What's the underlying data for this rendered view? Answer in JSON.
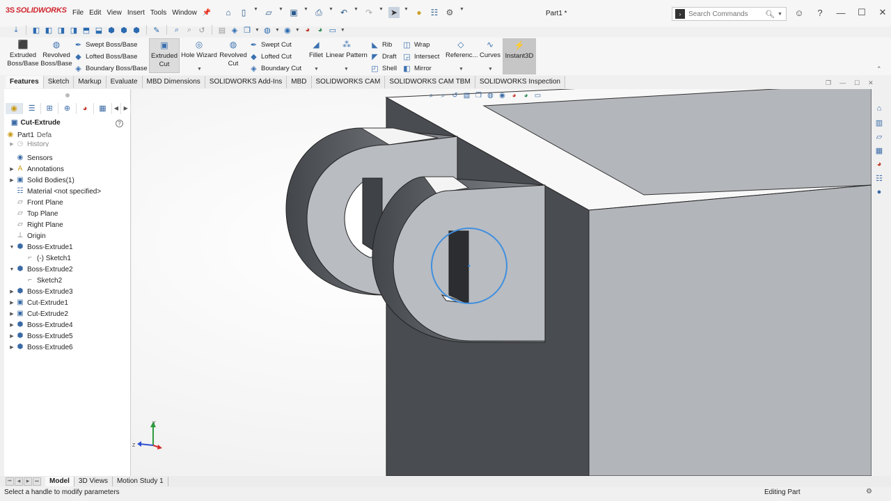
{
  "app": {
    "logo_ds": "3S",
    "logo_text": "SOLIDWORKS",
    "doc_title": "Part1 *"
  },
  "menu": [
    "File",
    "Edit",
    "View",
    "Insert",
    "Tools",
    "Window"
  ],
  "search": {
    "placeholder": "Search Commands"
  },
  "commands": {
    "extruded_boss": "Extruded Boss/Base",
    "revolved_boss": "Revolved Boss/Base",
    "swept_boss": "Swept Boss/Base",
    "lofted_boss": "Lofted Boss/Base",
    "boundary_boss": "Boundary Boss/Base",
    "extruded_cut": "Extruded Cut",
    "hole_wizard": "Hole Wizard",
    "revolved_cut": "Revolved Cut",
    "swept_cut": "Swept Cut",
    "lofted_cut": "Lofted Cut",
    "boundary_cut": "Boundary Cut",
    "fillet": "Fillet",
    "linear_pattern": "Linear Pattern",
    "rib": "Rib",
    "draft": "Draft",
    "shell": "Shell",
    "wrap": "Wrap",
    "intersect": "Intersect",
    "mirror": "Mirror",
    "reference": "Referenc...",
    "curves": "Curves",
    "instant3d": "Instant3D"
  },
  "tabs": [
    "Features",
    "Sketch",
    "Markup",
    "Evaluate",
    "MBD Dimensions",
    "SOLIDWORKS Add-Ins",
    "MBD",
    "SOLIDWORKS CAM",
    "SOLIDWORKS CAM TBM",
    "SOLIDWORKS Inspection"
  ],
  "panel": {
    "title": "Cut-Extrude",
    "part_name": "Part1",
    "part_suffix": "Defa",
    "history": "History",
    "items": [
      {
        "label": "Sensors",
        "icon": "sensor-icon",
        "exp": ""
      },
      {
        "label": "Annotations",
        "icon": "annotation-icon",
        "exp": "▶"
      },
      {
        "label": "Solid Bodies(1)",
        "icon": "solid-bodies-icon",
        "exp": "▶"
      },
      {
        "label": "Material <not specified>",
        "icon": "material-icon",
        "exp": ""
      },
      {
        "label": "Front Plane",
        "icon": "plane-icon",
        "exp": ""
      },
      {
        "label": "Top Plane",
        "icon": "plane-icon",
        "exp": ""
      },
      {
        "label": "Right Plane",
        "icon": "plane-icon",
        "exp": ""
      },
      {
        "label": "Origin",
        "icon": "origin-icon",
        "exp": ""
      },
      {
        "label": "Boss-Extrude1",
        "icon": "boss-extrude-icon",
        "exp": "▼"
      },
      {
        "label": "(-) Sketch1",
        "icon": "sketch-icon",
        "exp": "",
        "indent": true
      },
      {
        "label": "Boss-Extrude2",
        "icon": "boss-extrude-icon",
        "exp": "▼"
      },
      {
        "label": "Sketch2",
        "icon": "sketch-icon",
        "exp": "",
        "indent": true
      },
      {
        "label": "Boss-Extrude3",
        "icon": "boss-extrude-icon",
        "exp": "▶"
      },
      {
        "label": "Cut-Extrude1",
        "icon": "cut-extrude-icon",
        "exp": "▶"
      },
      {
        "label": "Cut-Extrude2",
        "icon": "cut-extrude-icon",
        "exp": "▶"
      },
      {
        "label": "Boss-Extrude4",
        "icon": "boss-extrude-icon",
        "exp": "▶"
      },
      {
        "label": "Boss-Extrude5",
        "icon": "boss-extrude-icon",
        "exp": "▶"
      },
      {
        "label": "Boss-Extrude6",
        "icon": "boss-extrude-icon",
        "exp": "▶"
      }
    ]
  },
  "triad": {
    "y": "Y",
    "z": "Z"
  },
  "bottom_tabs": [
    "Model",
    "3D Views",
    "Motion Study 1"
  ],
  "status": {
    "message": "Select a handle to modify parameters",
    "mode": "Editing Part"
  },
  "colors": {
    "accent": "#3a70b0",
    "selection_circle": "#3f8fdf",
    "face_light": "#ffffff",
    "face_mid": "#b0b4b9",
    "face_dark": "#484b50"
  }
}
